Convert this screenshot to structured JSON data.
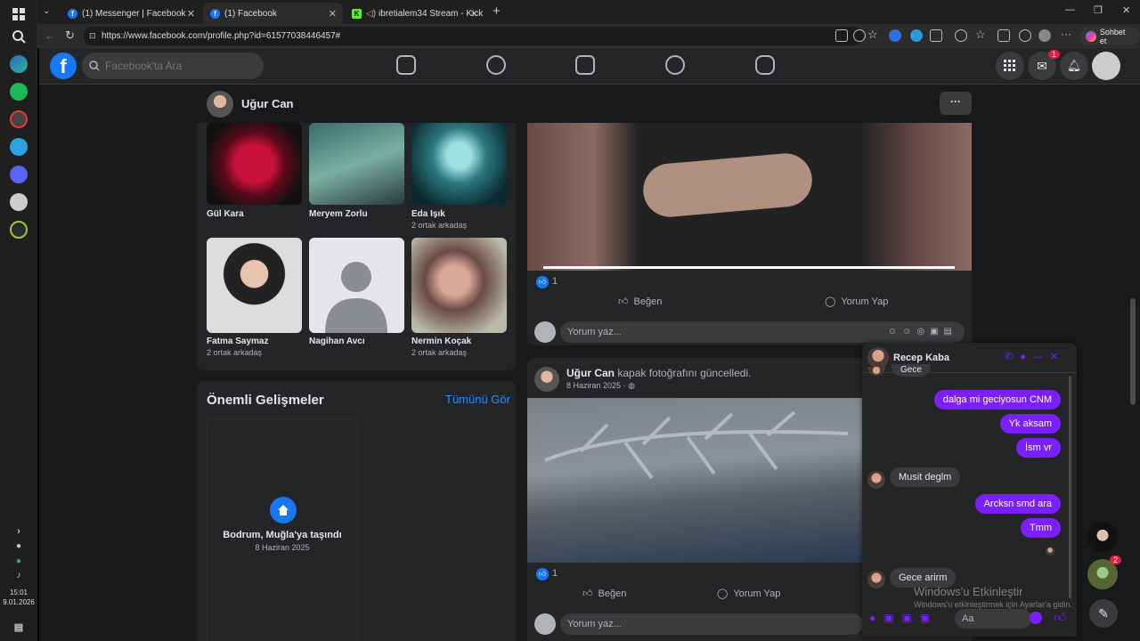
{
  "taskbar": {
    "time": "15:01",
    "date": "9.01.2026"
  },
  "browser": {
    "tabs": [
      {
        "label": "(1) Messenger | Facebook"
      },
      {
        "label": "(1) Facebook"
      },
      {
        "label": "ibretialem34 Stream - Kick Da"
      }
    ],
    "url": "https://www.facebook.com/profile.php?id=61577038446457#",
    "copilot_label": "Sohbet et"
  },
  "fb": {
    "search_placeholder": "Facebook'ta Ara",
    "messenger_badge": "1",
    "profile_name": "Uğur Can",
    "friends": [
      {
        "name": "Gül Kara",
        "sub": ""
      },
      {
        "name": "Meryem Zorlu",
        "sub": ""
      },
      {
        "name": "Eda Işık",
        "sub": "2 ortak arkadaş"
      },
      {
        "name": "Fatma Saymaz",
        "sub": "2 ortak arkadaş"
      },
      {
        "name": "Nagihan Avcı",
        "sub": ""
      },
      {
        "name": "Nermin Koçak",
        "sub": "2 ortak arkadaş"
      }
    ],
    "life_events": {
      "title": "Önemli Gelişmeler",
      "see_all": "Tümünü Gör",
      "event_title": "Bodrum, Muğla'ya taşındı",
      "event_date": "8 Haziran 2025"
    },
    "post1": {
      "likes": "1",
      "like_label": "Beğen",
      "comment_label": "Yorum Yap",
      "comment_placeholder": "Yorum yaz..."
    },
    "post2": {
      "author": "Uğur Can",
      "action": "kapak fotoğrafını güncelledi.",
      "date": "8 Haziran 2025 ·",
      "likes": "1",
      "like_label": "Beğen",
      "comment_label": "Yorum Yap",
      "comment_placeholder": "Yorum yaz..."
    },
    "chat": {
      "name": "Recep Kaba",
      "messages": [
        {
          "text": "Gece",
          "dir": "in"
        },
        {
          "text": "dalga mi geciyosun CNM",
          "dir": "out"
        },
        {
          "text": "Yk aksam",
          "dir": "out"
        },
        {
          "text": "İsm vr",
          "dir": "out"
        },
        {
          "text": "Musit deglm",
          "dir": "in"
        },
        {
          "text": "Arcksn smd ara",
          "dir": "out"
        },
        {
          "text": "Tmm",
          "dir": "out"
        },
        {
          "text": "Gece arirm",
          "dir": "in"
        }
      ],
      "input_placeholder": "Aa"
    },
    "side_badge": "2",
    "watermark_title": "Windows'u Etkinleştir",
    "watermark_sub": "Windows'u etkinleştirmek için Ayarlar'a gidin."
  },
  "colors": {
    "fb_blue": "#1877f2",
    "messenger_purple": "#7b1fff",
    "badge_red": "#e41e3f"
  }
}
